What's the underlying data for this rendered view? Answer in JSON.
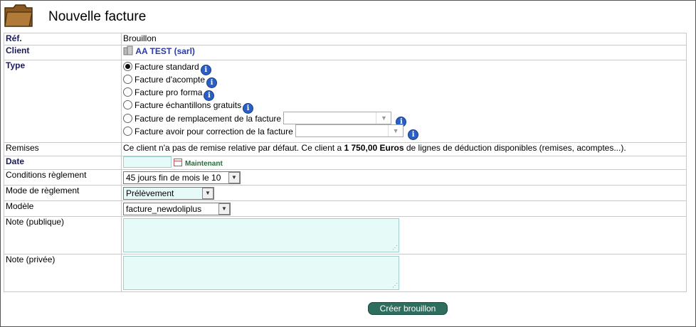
{
  "page": {
    "title": "Nouvelle facture"
  },
  "rows": {
    "ref": {
      "label": "Réf.",
      "value": "Brouillon"
    },
    "client": {
      "label": "Client",
      "value": "AA TEST (sarl)"
    },
    "type": {
      "label": "Type",
      "options": [
        "Facture standard",
        "Facture d'acompte",
        "Facture pro forma",
        "Facture échantillons gratuits",
        "Facture de remplacement de la facture",
        "Facture avoir pour correction de la facture"
      ],
      "selected": "Facture standard"
    },
    "remises": {
      "label": "Remises",
      "text_before": "Ce client n'a pas de remise relative par défaut. Ce client a ",
      "amount": "1 750,00 Euros",
      "text_after": " de lignes de déduction disponibles (remises, acomptes...)."
    },
    "date": {
      "label": "Date",
      "value": "",
      "now_label": "Maintenant"
    },
    "conditions": {
      "label": "Conditions règlement",
      "value": "45 jours fin de mois le 10"
    },
    "mode": {
      "label": "Mode de règlement",
      "value": "Prélèvement"
    },
    "modele": {
      "label": "Modèle",
      "value": "facture_newdoliplus"
    },
    "note_publique": {
      "label": "Note (publique)",
      "value": ""
    },
    "note_privee": {
      "label": "Note (privée)",
      "value": ""
    }
  },
  "actions": {
    "create": "Créer brouillon"
  },
  "icons": {
    "title": "folder-icon",
    "client": "company-icon",
    "info": "info-icon",
    "calendar": "calendar-icon"
  },
  "colors": {
    "accent_button": "#2d6e5e",
    "input_bg": "#e6fbf8",
    "link": "#2a3aa8"
  }
}
